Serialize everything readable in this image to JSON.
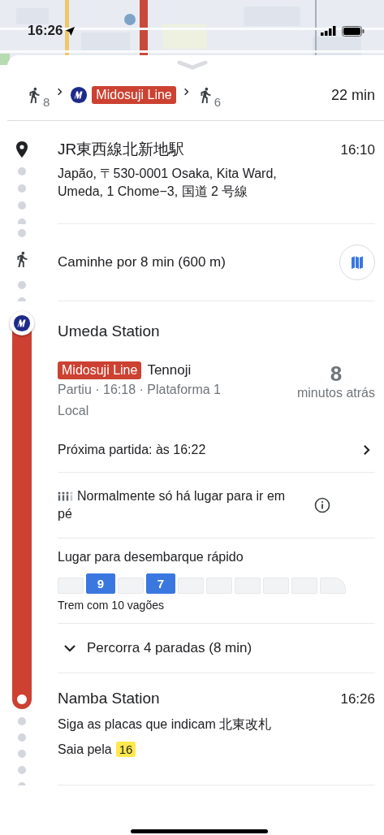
{
  "status_bar": {
    "time": "16:26"
  },
  "summary": {
    "walk_start": "8",
    "line": "Midosuji Line",
    "walk_end": "6",
    "duration": "22 min"
  },
  "start": {
    "name": "JR東西線北新地駅",
    "time": "16:10",
    "address": "Japão, 〒530-0001 Osaka, Kita Ward, Umeda, 1 Chome−3, 国道 2 号線"
  },
  "walk": {
    "text": "Caminhe por 8 min (600 m)"
  },
  "transit": {
    "station": "Umeda Station",
    "line": "Midosuji Line",
    "headsign": "Tennoji",
    "details": "Partiu · 16:18 · Plataforma 1",
    "service": "Local",
    "countdown": "8",
    "countdown_label": "minutos atrás",
    "next": "Próxima partida: às 16:22",
    "crowding": "Normalmente só há lugar para ir em pé",
    "exit_title": "Lugar para desembarque rápido",
    "cars": [
      {
        "selected": false
      },
      {
        "label": "9",
        "selected": true
      },
      {
        "selected": false
      },
      {
        "label": "7",
        "selected": true
      },
      {
        "selected": false
      },
      {
        "selected": false
      },
      {
        "selected": false
      },
      {
        "selected": false
      },
      {
        "selected": false
      },
      {
        "selected": false
      }
    ],
    "cars_caption": "Trem com 10 vagões",
    "stops": "Percorra 4 paradas (8 min)",
    "expanded": false
  },
  "end": {
    "station": "Namba Station",
    "time": "16:26",
    "directions": "Siga as placas que indicam 北東改札",
    "exit_prefix": "Saia pela",
    "exit": "16"
  }
}
